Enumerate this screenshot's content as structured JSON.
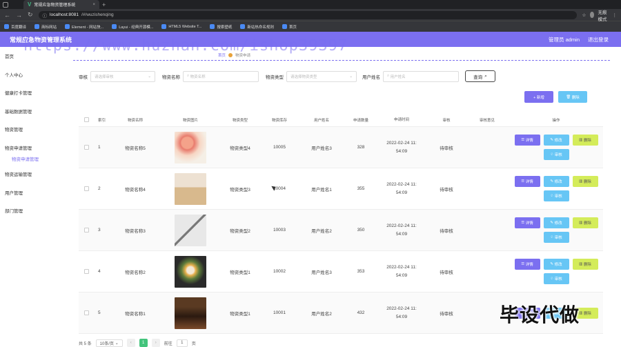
{
  "browser": {
    "tab_title": "常规应急物资管理系统",
    "url_host": "localhost:8081",
    "url_path": "/#/wuzishenqing",
    "profile_label": "无痕模式",
    "bookmarks": [
      "百度翻译",
      "商标网站",
      "Element - 网站快...",
      "Layui - 经典开源模...",
      "HTML5 Website T...",
      "搜索壁纸",
      "新站热命名规则",
      "首页"
    ]
  },
  "header": {
    "title": "常规应急物资管理系统",
    "admin_label": "管理员 admin",
    "logout_label": "退出登录"
  },
  "watermark": "https://www.huzhan.com/ishop39397",
  "stamp": "毕设代做",
  "sidebar": {
    "items": [
      "首页",
      "个人中心",
      "健康打卡管理",
      "基础数据管理",
      "物资管理",
      "物资申请管理",
      "物资申请管理",
      "物资运输管理",
      "用户管理",
      "部门管理"
    ]
  },
  "breadcrumb": {
    "home": "首页",
    "current": "物资申请"
  },
  "search": {
    "status_label": "审核",
    "status_placeholder": "请选择审核",
    "name_label": "物资名称",
    "name_placeholder": "物资名称",
    "type_label": "物资类型",
    "type_placeholder": "请选择物资类型",
    "user_label": "用户姓名",
    "user_placeholder": "用户姓名",
    "query_label": "查询"
  },
  "actions": {
    "add_label": "+ 新增",
    "delete_label": "删除"
  },
  "table": {
    "columns": [
      "索引",
      "物资名称",
      "物资图片",
      "物资类型",
      "物资库存",
      "用户姓名",
      "申请数量",
      "申请时间",
      "审核",
      "审核意见",
      "操作"
    ],
    "rows": [
      {
        "idx": "1",
        "name": "物资名称5",
        "type": "物资类型4",
        "stock": "10005",
        "user": "用户姓名3",
        "qty": "328",
        "time1": "2022-02-24 11:",
        "time2": "54:09",
        "status": "待审核",
        "reply": ""
      },
      {
        "idx": "2",
        "name": "物资名称4",
        "type": "物资类型3",
        "stock": "10004",
        "user": "用户姓名1",
        "qty": "355",
        "time1": "2022-02-24 11:",
        "time2": "54:09",
        "status": "待审核",
        "reply": ""
      },
      {
        "idx": "3",
        "name": "物资名称3",
        "type": "物资类型2",
        "stock": "10003",
        "user": "用户姓名2",
        "qty": "350",
        "time1": "2022-02-24 11:",
        "time2": "54:09",
        "status": "待审核",
        "reply": ""
      },
      {
        "idx": "4",
        "name": "物资名称2",
        "type": "物资类型1",
        "stock": "10002",
        "user": "用户姓名3",
        "qty": "353",
        "time1": "2022-02-24 11:",
        "time2": "54:09",
        "status": "待审核",
        "reply": ""
      },
      {
        "idx": "5",
        "name": "物资名称1",
        "type": "物资类型1",
        "stock": "10001",
        "user": "用户姓名2",
        "qty": "432",
        "time1": "2022-02-24 11:",
        "time2": "54:09",
        "status": "待审核",
        "reply": ""
      }
    ],
    "ops": {
      "detail": "详情",
      "edit": "修改",
      "delete": "删除",
      "review": "审核"
    }
  },
  "pager": {
    "total": "共 5 条",
    "page_size": "10条/页",
    "current": "1",
    "goto_label": "前往",
    "goto_value": "1",
    "page_suffix": "页"
  }
}
